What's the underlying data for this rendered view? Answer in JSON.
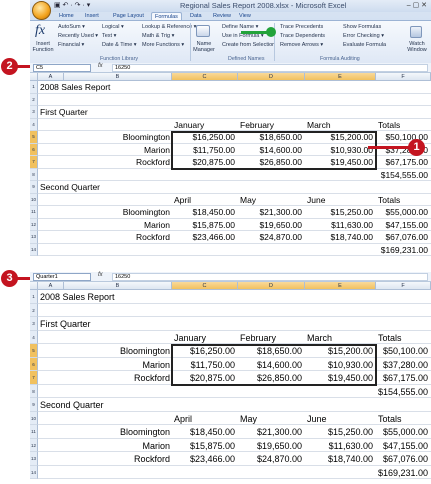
{
  "window": {
    "title": "Regional Sales Report 2008.xlsx - Microsoft Excel",
    "qat": "▣ ↶ · ↷ · ▾"
  },
  "ribbon": {
    "tabs": [
      "Home",
      "Insert",
      "Page Layout",
      "Formulas",
      "Data",
      "Review",
      "View"
    ],
    "active_tab": "Formulas",
    "insert_function": "Insert Function",
    "fx_symbol": "fx",
    "library_items": [
      "AutoSum ▾",
      "Recently Used ▾",
      "Financial ▾",
      "Logical ▾",
      "Text ▾",
      "Date & Time ▾",
      "Lookup & Reference ▾",
      "Math & Trig ▾",
      "More Functions ▾"
    ],
    "library_label": "Function Library",
    "name_manager": "Name Manager",
    "define_name": "Define Name ▾",
    "use_in_formula": "Use in Formula ▾",
    "create_from_selection": "Create from Selection",
    "defined_names_label": "Defined Names",
    "auditing_items": [
      "Trace Precedents",
      "Trace Dependents",
      "Remove Arrows ▾",
      "Show Formulas",
      "Error Checking ▾",
      "Evaluate Formula"
    ],
    "auditing_label": "Formula Auditing",
    "watch_window": "Watch Window"
  },
  "top": {
    "namebox": "C5",
    "formula": "16250"
  },
  "bottom": {
    "namebox": "Quarter1",
    "formula": "16250"
  },
  "callouts": {
    "one": "1",
    "two": "2",
    "three": "3"
  },
  "columns": [
    "A",
    "B",
    "C",
    "D",
    "E",
    "F"
  ],
  "rows": [
    "1",
    "2",
    "3",
    "4",
    "5",
    "6",
    "7",
    "8",
    "9",
    "10",
    "11",
    "12",
    "13",
    "14"
  ],
  "sheet": {
    "title": "2008 Sales Report",
    "q1": "First Quarter",
    "q2": "Second Quarter",
    "q1_months": [
      "January",
      "February",
      "March",
      "Totals"
    ],
    "q2_months": [
      "April",
      "May",
      "June",
      "Totals"
    ],
    "q1_rows": [
      {
        "name": "Bloomington",
        "v": [
          "$16,250.00",
          "$18,650.00",
          "$15,200.00",
          "$50,100.00"
        ]
      },
      {
        "name": "Marion",
        "v": [
          "$11,750.00",
          "$14,600.00",
          "$10,930.00",
          "$37,280.00"
        ]
      },
      {
        "name": "Rockford",
        "v": [
          "$20,875.00",
          "$26,850.00",
          "$19,450.00",
          "$67,175.00"
        ]
      }
    ],
    "q1_total": "$154,555.00",
    "q2_rows": [
      {
        "name": "Bloomington",
        "v": [
          "$18,450.00",
          "$21,300.00",
          "$15,250.00",
          "$55,000.00"
        ]
      },
      {
        "name": "Marion",
        "v": [
          "$15,875.00",
          "$19,650.00",
          "$11,630.00",
          "$47,155.00"
        ]
      },
      {
        "name": "Rockford",
        "v": [
          "$23,466.00",
          "$24,870.00",
          "$18,740.00",
          "$67,076.00"
        ]
      }
    ],
    "q2_total": "$169,231.00"
  },
  "colors": {
    "callout": "#c41420",
    "selected_header": "#f1c15f"
  }
}
